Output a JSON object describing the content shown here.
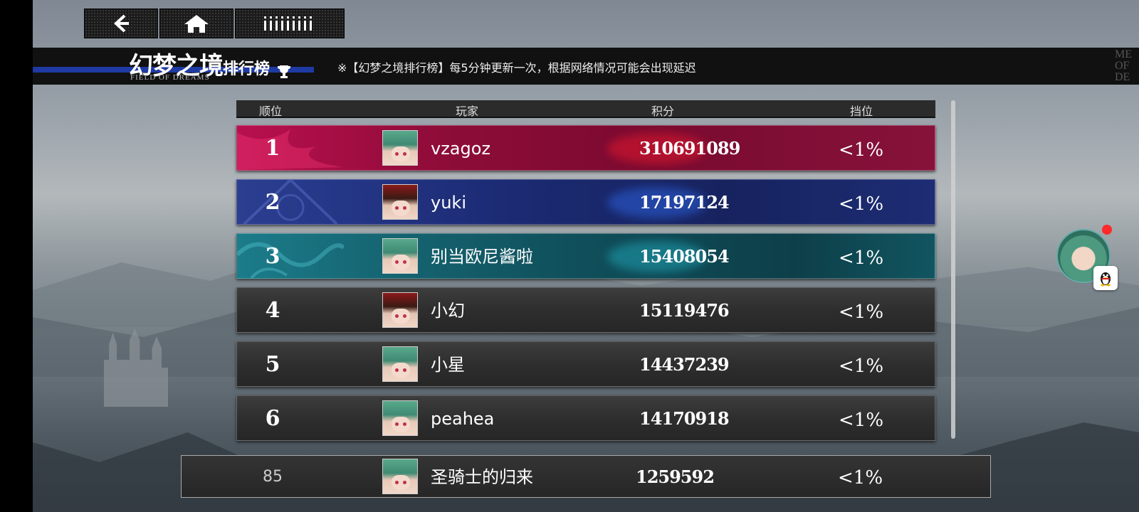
{
  "header": {
    "title_main": "幻梦之境",
    "title_sub": "排行榜",
    "title_en": "FIELD OF DREAMS",
    "notice": "※【幻梦之境排行榜】每5分钟更新一次，根据网络情况可能会出现延迟",
    "corner_text": [
      "ME",
      "OF",
      "DE"
    ]
  },
  "nav": {
    "back_icon": "back-arrow-icon",
    "home_icon": "home-icon",
    "menu_icon": "menu-dots-icon"
  },
  "table": {
    "columns": [
      "顺位",
      "玩家",
      "积分",
      "挡位"
    ],
    "rows": [
      {
        "rank": "1",
        "name": "vzagoz",
        "score": "310691089",
        "tier": "<1%",
        "style": "crimson"
      },
      {
        "rank": "2",
        "name": "yuki",
        "score": "17197124",
        "tier": "<1%",
        "style": "blue"
      },
      {
        "rank": "3",
        "name": "别当欧尼酱啦",
        "score": "15408054",
        "tier": "<1%",
        "style": "teal"
      },
      {
        "rank": "4",
        "name": "小幻",
        "score": "15119476",
        "tier": "<1%",
        "style": "dark"
      },
      {
        "rank": "5",
        "name": "小星",
        "score": "14437239",
        "tier": "<1%",
        "style": "dark"
      },
      {
        "rank": "6",
        "name": "peahea",
        "score": "14170918",
        "tier": "<1%",
        "style": "dark"
      }
    ]
  },
  "self": {
    "rank": "85",
    "name": "圣骑士的归来",
    "score": "1259592",
    "tier": "<1%"
  },
  "colors": {
    "rank1": "#a80e45",
    "rank2": "#1b2a72",
    "rank3": "#0f4e5a",
    "accent_line": "#1f3aa3",
    "notif": "#ff2a2a"
  }
}
